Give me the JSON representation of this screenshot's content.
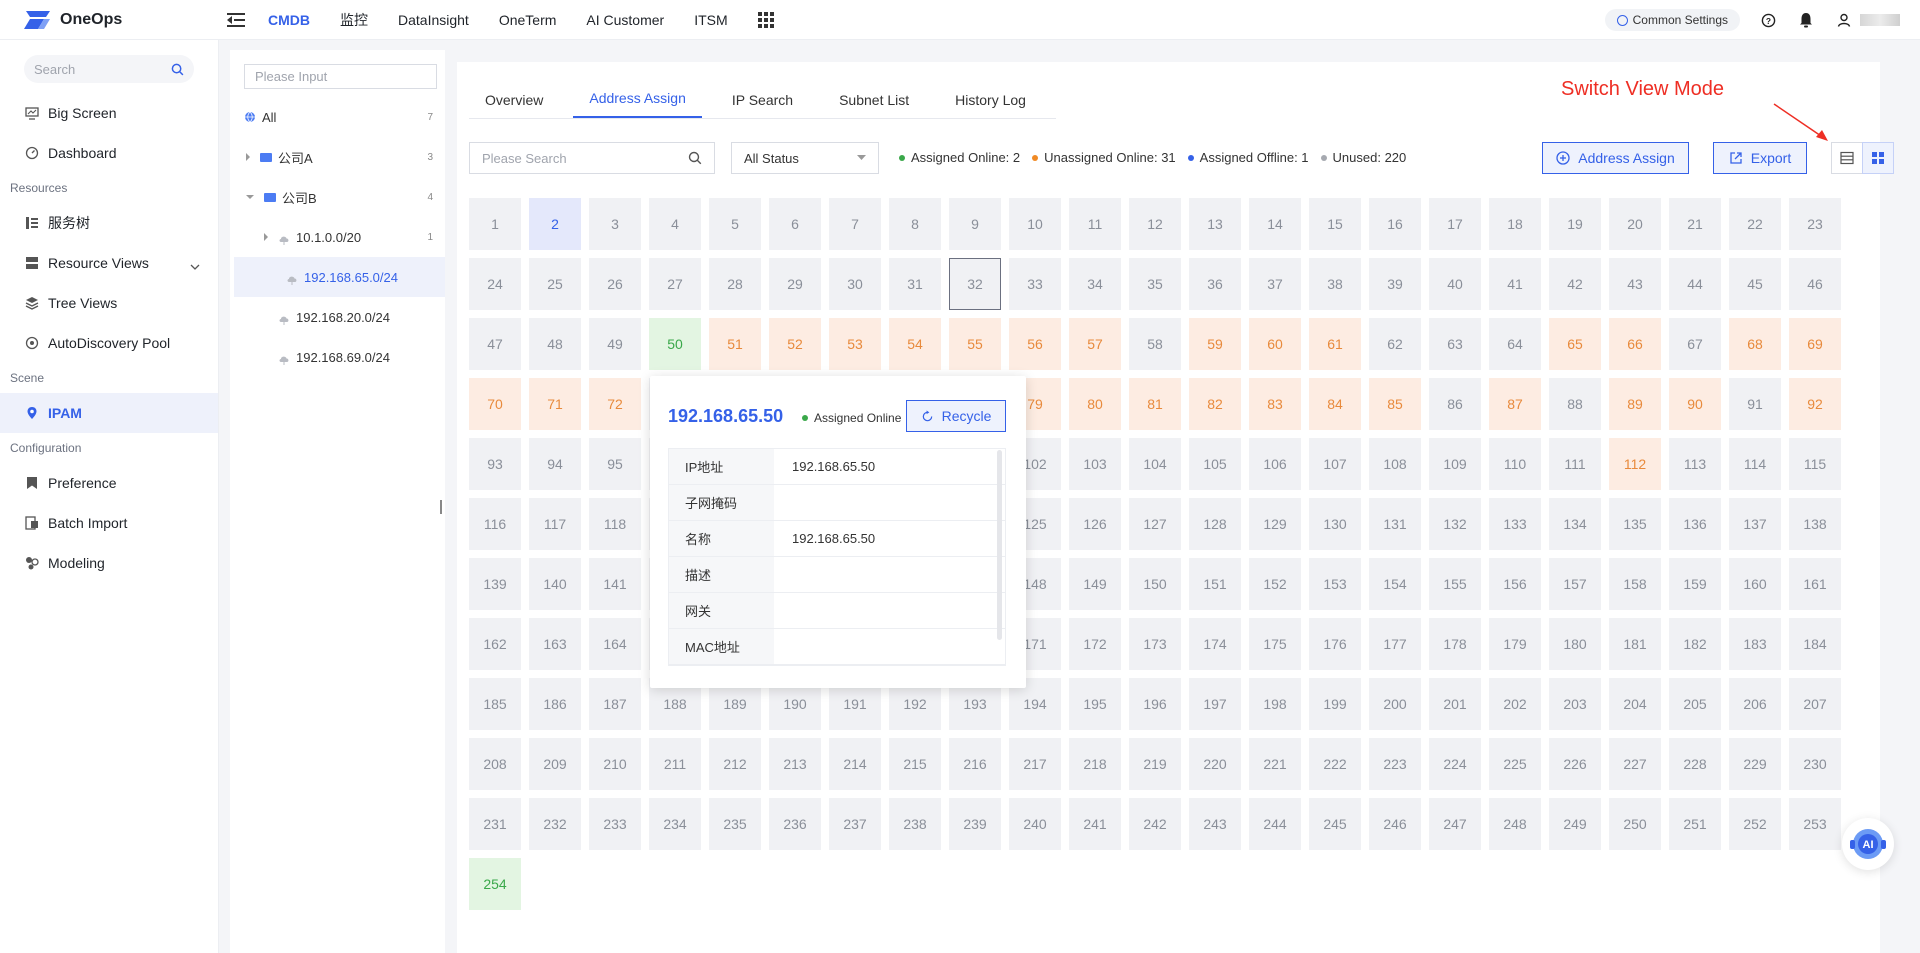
{
  "topbar": {
    "logo_text": "OneOps",
    "nav": [
      "CMDB",
      "监控",
      "DataInsight",
      "OneTerm",
      "AI Customer",
      "ITSM"
    ],
    "active_nav": 0,
    "common_settings": "Common Settings"
  },
  "sidebar": {
    "search_placeholder": "Search",
    "top_items": [
      {
        "label": "Big Screen",
        "icon": "monitor-icon"
      },
      {
        "label": "Dashboard",
        "icon": "dashboard-icon"
      }
    ],
    "groups": [
      {
        "label": "Resources",
        "items": [
          {
            "label": "服务树",
            "icon": "tree-list-icon"
          },
          {
            "label": "Resource Views",
            "icon": "views-icon",
            "chevron": true
          },
          {
            "label": "Tree Views",
            "icon": "layers-icon"
          },
          {
            "label": "AutoDiscovery Pool",
            "icon": "discovery-icon"
          }
        ]
      },
      {
        "label": "Scene",
        "items": [
          {
            "label": "IPAM",
            "icon": "location-icon",
            "active": true
          }
        ]
      },
      {
        "label": "Configuration",
        "items": [
          {
            "label": "Preference",
            "icon": "bookmark-icon"
          },
          {
            "label": "Batch Import",
            "icon": "import-icon"
          },
          {
            "label": "Modeling",
            "icon": "modeling-icon"
          }
        ]
      }
    ]
  },
  "tree": {
    "input_placeholder": "Please Input",
    "all_label": "All",
    "all_count": "7",
    "nodes": [
      {
        "label": "公司A",
        "count": "3",
        "depth": 1,
        "type": "folder",
        "expander": "right"
      },
      {
        "label": "公司B",
        "count": "4",
        "depth": 1,
        "type": "folder",
        "expander": "down"
      },
      {
        "label": "10.1.0.0/20",
        "count": "1",
        "depth": 2,
        "type": "net",
        "expander": "right"
      },
      {
        "label": "192.168.65.0/24",
        "count": "",
        "depth": 2,
        "type": "net",
        "expander": "none",
        "selected": true
      },
      {
        "label": "192.168.20.0/24",
        "count": "",
        "depth": 2,
        "type": "net",
        "expander": "none"
      },
      {
        "label": "192.168.69.0/24",
        "count": "",
        "depth": 2,
        "type": "net",
        "expander": "none"
      }
    ]
  },
  "tabs": [
    "Overview",
    "Address Assign",
    "IP Search",
    "Subnet List",
    "History Log"
  ],
  "active_tab": 1,
  "annotation": "Switch View Mode",
  "toolbar": {
    "search_placeholder": "Please Search",
    "status_value": "All Status",
    "legend": [
      {
        "label": "Assigned Online: 2",
        "color": "#3aa84a"
      },
      {
        "label": "Unassigned Online: 31",
        "color": "#f08a24"
      },
      {
        "label": "Assigned Offline: 1",
        "color": "#3561e8"
      },
      {
        "label": "Unused: 220",
        "color": "#a6a9b0"
      }
    ],
    "assign_label": "Address Assign",
    "export_label": "Export"
  },
  "ip_grid": {
    "total": 254,
    "assigned_online": [
      50,
      254
    ],
    "assigned_offline": [
      2
    ],
    "unassigned_online": [
      51,
      52,
      53,
      54,
      55,
      56,
      57,
      59,
      60,
      61,
      65,
      66,
      68,
      69,
      70,
      71,
      72,
      79,
      80,
      81,
      82,
      83,
      84,
      85,
      87,
      89,
      90,
      92,
      112
    ],
    "hovered": 32
  },
  "popover": {
    "ip": "192.168.65.50",
    "status": "Assigned Online",
    "recycle_label": "Recycle",
    "fields": [
      {
        "k": "IP地址",
        "v": "192.168.65.50"
      },
      {
        "k": "子网掩码",
        "v": ""
      },
      {
        "k": "名称",
        "v": "192.168.65.50"
      },
      {
        "k": "描述",
        "v": ""
      },
      {
        "k": "网关",
        "v": ""
      },
      {
        "k": "MAC地址",
        "v": ""
      }
    ]
  },
  "ai_fab_label": "AI"
}
